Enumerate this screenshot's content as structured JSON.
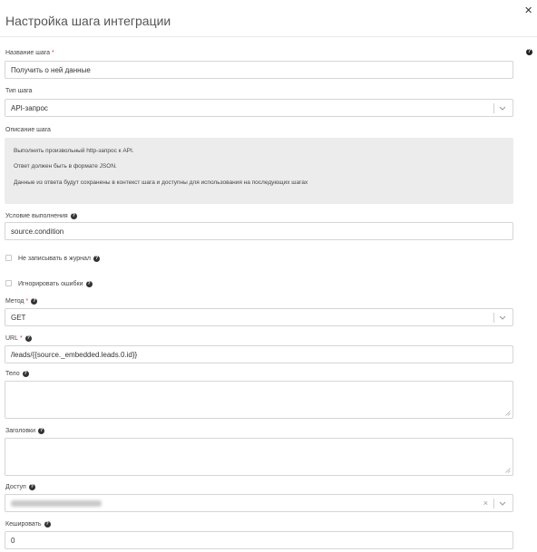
{
  "modal": {
    "title": "Настройка шага интеграции",
    "close_icon": "close-icon",
    "help_icon": "help-icon"
  },
  "form": {
    "step_name": {
      "label": "Название шага",
      "required_mark": "*",
      "value": "Получить о ней данные"
    },
    "step_type": {
      "label": "Тип шага",
      "value": "API-запрос"
    },
    "description": {
      "label": "Описание шага",
      "lines": [
        "Выполнить произвольный http-запрос к API.",
        "Ответ должен быть в формате JSON.",
        "Данные из ответа будут сохранены в контекст шага и доступны для использования на последующих шагах"
      ]
    },
    "condition": {
      "label": "Условие выполнения",
      "help_glyph": "?",
      "value": "source.condition"
    },
    "no_log": {
      "label": "Не записывать в журнал",
      "help_glyph": "?",
      "checked": false
    },
    "ignore_errors": {
      "label": "Игнорировать ошибки",
      "help_glyph": "?",
      "checked": false
    },
    "method": {
      "label": "Метод",
      "required_mark": "*",
      "help_glyph": "?",
      "value": "GET"
    },
    "url": {
      "label": "URL",
      "required_mark": "*",
      "help_glyph": "?",
      "value": "/leads/{{source._embedded.leads.0.id}}"
    },
    "body": {
      "label": "Тело",
      "help_glyph": "?",
      "value": ""
    },
    "headers": {
      "label": "Заголовки",
      "help_glyph": "?",
      "value": ""
    },
    "access": {
      "label": "Доступ",
      "help_glyph": "?",
      "clear_glyph": "×"
    },
    "cache": {
      "label": "Кешировать",
      "help_glyph": "?",
      "value": "0"
    }
  },
  "colors": {
    "required": "#e53935",
    "description_bg": "#ececec",
    "border": "#d5d5d5"
  }
}
